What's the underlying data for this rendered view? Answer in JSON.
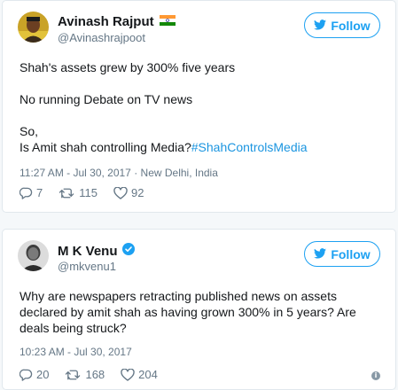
{
  "tweets": [
    {
      "name": "Avinash Rajput",
      "handle": "@Avinashrajpoot",
      "follow_label": "Follow",
      "lines": [
        "Shah's assets grew by 300% five years",
        "No running Debate on TV news",
        "So,"
      ],
      "last_line_text": "Is Amit shah controlling Media?",
      "hashtag": "#ShahControlsMedia",
      "timestamp": "11:27 AM - Jul 30, 2017 · New Delhi, India",
      "replies": "7",
      "retweets": "115",
      "likes": "92"
    },
    {
      "name": "M K Venu",
      "handle": "@mkvenu1",
      "follow_label": "Follow",
      "text": "Why are newspapers retracting published news on assets declared by amit shah as having grown 300% in 5 years? Are deals being struck?",
      "timestamp": "10:23 AM - Jul 30, 2017",
      "replies": "20",
      "retweets": "168",
      "likes": "204"
    }
  ],
  "colors": {
    "accent": "#1da1f2",
    "hashtag": "#1b95e0",
    "muted": "#657786",
    "border": "#e1e8ed"
  }
}
